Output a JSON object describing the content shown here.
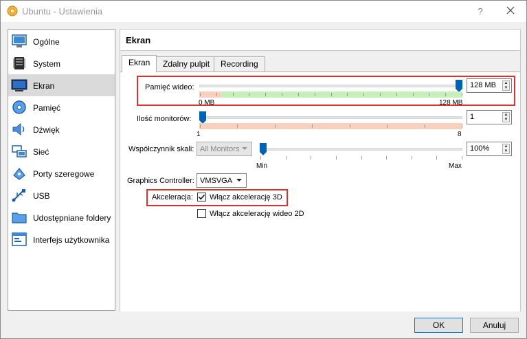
{
  "window": {
    "title": "Ubuntu - Ustawienia",
    "help_label": "?"
  },
  "sidebar": {
    "items": [
      {
        "label": "Ogólne",
        "icon": "general-icon",
        "active": false
      },
      {
        "label": "System",
        "icon": "system-icon",
        "active": false
      },
      {
        "label": "Ekran",
        "icon": "display-icon",
        "active": true
      },
      {
        "label": "Pamięć",
        "icon": "storage-icon",
        "active": false
      },
      {
        "label": "Dźwięk",
        "icon": "audio-icon",
        "active": false
      },
      {
        "label": "Sieć",
        "icon": "network-icon",
        "active": false
      },
      {
        "label": "Porty szeregowe",
        "icon": "serial-ports-icon",
        "active": false
      },
      {
        "label": "USB",
        "icon": "usb-icon",
        "active": false
      },
      {
        "label": "Udostępniane foldery",
        "icon": "shared-folders-icon",
        "active": false
      },
      {
        "label": "Interfejs użytkownika",
        "icon": "user-interface-icon",
        "active": false
      }
    ]
  },
  "section": {
    "title": "Ekran"
  },
  "tabs": [
    {
      "label": "Ekran",
      "active": true
    },
    {
      "label": "Zdalny pulpit",
      "active": false
    },
    {
      "label": "Recording",
      "active": false
    }
  ],
  "video_memory": {
    "label": "Pamięć wideo:",
    "value": "128 MB",
    "min_label": "0 MB",
    "max_label": "128 MB",
    "level": 1.0
  },
  "monitors": {
    "label": "Ilość monitorów:",
    "value": "1",
    "min_label": "1",
    "max_label": "8",
    "level": 0.0
  },
  "scale": {
    "label": "Współczynnik skali:",
    "combo_value": "All Monitors",
    "value": "100%",
    "min_label": "Min",
    "max_label": "Max",
    "level": 0.0
  },
  "graphics_controller": {
    "label": "Graphics Controller:",
    "value": "VMSVGA"
  },
  "acceleration": {
    "label": "Akceleracja:",
    "accel_3d_label": "Włącz akcelerację 3D",
    "accel_3d_checked": true,
    "accel_2d_label": "Włącz akcelerację wideo 2D",
    "accel_2d_checked": false
  },
  "buttons": {
    "ok": "OK",
    "cancel": "Anuluj"
  },
  "colors": {
    "highlight_border": "#e0302c",
    "slider_thumb": "#0063b1",
    "recommended_range": "#c6efb9",
    "warning_range": "#f8d0c0"
  }
}
